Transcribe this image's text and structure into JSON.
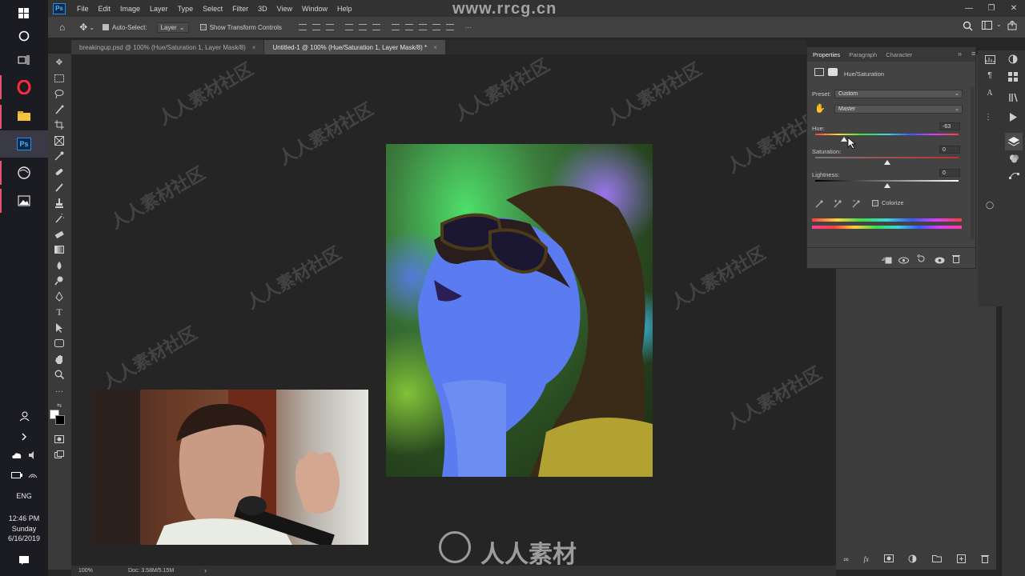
{
  "taskbar": {
    "icons": [
      "windows-icon",
      "search-circle-icon",
      "task-view-icon",
      "opera-icon",
      "file-explorer-icon",
      "photoshop-icon",
      "browser-icon",
      "photos-icon"
    ],
    "tray": {
      "language": "ENG",
      "time": "12:46 PM",
      "day": "Sunday",
      "date": "6/16/2019"
    }
  },
  "app": {
    "logo": "Ps",
    "menu": [
      "File",
      "Edit",
      "Image",
      "Layer",
      "Type",
      "Select",
      "Filter",
      "3D",
      "View",
      "Window",
      "Help"
    ],
    "watermark_url": "www.rrcg.cn"
  },
  "options": {
    "auto_select_label": "Auto-Select:",
    "auto_select_value": "Layer",
    "transform_label": "Show Transform Controls",
    "more": "···"
  },
  "tabs": [
    {
      "label": "breakingup.psd @ 100% (Hue/Saturation 1, Layer Mask/8)",
      "close": "×"
    },
    {
      "label": "Untitled-1 @ 100% (Hue/Saturation 1, Layer Mask/8) *",
      "close": "×"
    }
  ],
  "properties": {
    "tabs": [
      "Properties",
      "Paragraph",
      "Character"
    ],
    "adjustment_title": "Hue/Saturation",
    "preset_label": "Preset:",
    "preset_value": "Custom",
    "channel_value": "Master",
    "hue_label": "Hue:",
    "hue_value": "-63",
    "saturation_label": "Saturation:",
    "saturation_value": "0",
    "lightness_label": "Lightness:",
    "lightness_value": "0",
    "colorize_label": "Colorize",
    "hue_fraction": 0.2,
    "saturation_fraction": 0.5,
    "lightness_fraction": 0.5
  },
  "status": {
    "zoom": "100%",
    "doc": "Doc: 3.58M/5.15M"
  },
  "watermark": {
    "repeat_text": "人人素材社区",
    "logo_text": "人人素材"
  },
  "colors": {
    "ps_blue": "#2d8de8",
    "taskbar_accent": "#e6556f"
  }
}
